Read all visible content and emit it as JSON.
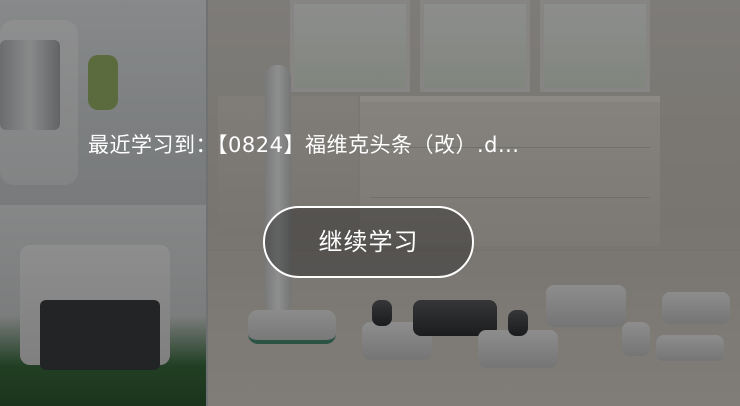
{
  "resume": {
    "label": "最近学习到：",
    "item_title": "【0824】福维克头条（改）.d..."
  },
  "actions": {
    "continue_label": "继续学习"
  },
  "overlay_color": "#000000",
  "accent_color": "#ffffff"
}
